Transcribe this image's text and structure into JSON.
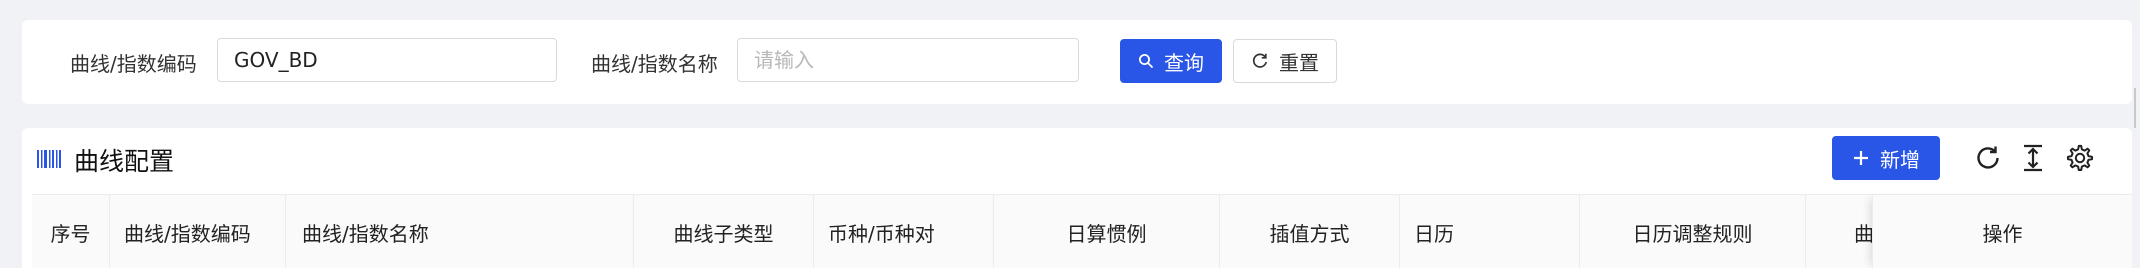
{
  "search": {
    "code_label": "曲线/指数编码",
    "code_value": "GOV_BD",
    "name_label": "曲线/指数名称",
    "name_placeholder": "请输入",
    "query_label": "查询",
    "reset_label": "重置"
  },
  "table": {
    "title": "曲线配置",
    "add_label": "新增",
    "columns": [
      "序号",
      "曲线/指数编码",
      "曲线/指数名称",
      "曲线子类型",
      "币种/币种对",
      "日算惯例",
      "插值方式",
      "日历",
      "日历调整规则",
      "曲",
      "操作"
    ]
  },
  "colors": {
    "primary": "#2a56e8",
    "background": "#f0f2f5",
    "header_bg": "#fafafa"
  },
  "icons": {
    "title_icon": "barcode-icon",
    "query_icon": "search-icon",
    "reset_icon": "refresh-icon",
    "add_icon": "plus-icon",
    "toolbar": [
      "reload-icon",
      "column-height-icon",
      "settings-icon"
    ]
  }
}
